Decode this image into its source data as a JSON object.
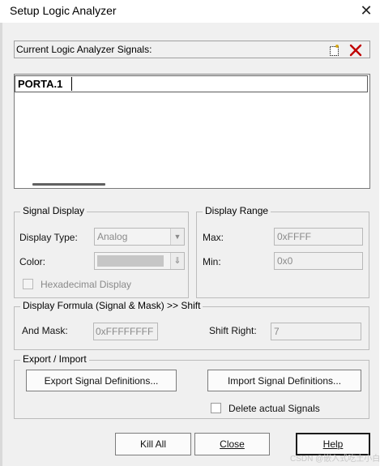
{
  "window": {
    "title": "Setup Logic Analyzer",
    "close_glyph": "✕"
  },
  "signals": {
    "header_label": "Current Logic Analyzer Signals:",
    "new_icon": "new-document-icon",
    "delete_icon": "delete-x-icon",
    "delete_color": "#c00000",
    "items": [
      "PORTA.1"
    ]
  },
  "signal_display": {
    "legend": "Signal Display",
    "display_type_label": "Display Type:",
    "display_type_value": "Analog",
    "color_label": "Color:",
    "hex_label": "Hexadecimal Display",
    "hex_checked": false
  },
  "display_range": {
    "legend": "Display Range",
    "max_label": "Max:",
    "max_value": "0xFFFF",
    "min_label": "Min:",
    "min_value": "0x0"
  },
  "display_formula": {
    "legend": "Display Formula (Signal & Mask) >> Shift",
    "and_mask_label": "And Mask:",
    "and_mask_value": "0xFFFFFFFF",
    "shift_right_label": "Shift Right:",
    "shift_right_value": "7"
  },
  "export_import": {
    "legend": "Export / Import",
    "export_button": "Export Signal Definitions...",
    "import_button": "Import Signal Definitions...",
    "delete_actual_label": "Delete actual Signals",
    "delete_actual_checked": false
  },
  "footer": {
    "kill_all": "Kill All",
    "close": "Close",
    "help": "Help"
  },
  "watermark": "CSDN @嵌入式吃土小白"
}
